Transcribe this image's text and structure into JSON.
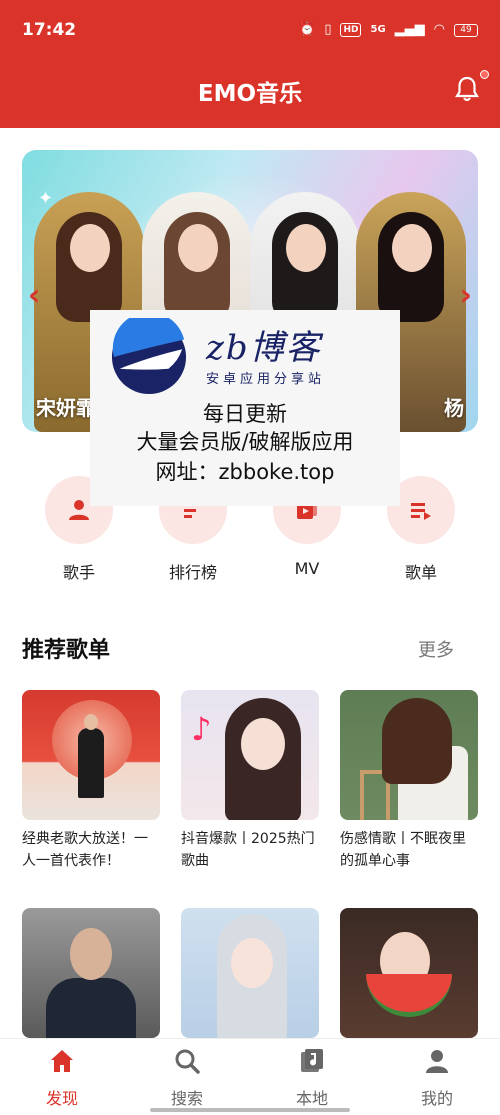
{
  "status_bar": {
    "time": "17:42",
    "hd": "HD",
    "network": "5G",
    "battery": "49"
  },
  "header": {
    "title": "EMO音乐",
    "icon": "bell-icon",
    "accent_color": "#d9332a"
  },
  "banner": {
    "caption_left": "宋妍霏",
    "caption_right": "杨"
  },
  "watermark": {
    "brand": "zb博客",
    "sub": "安卓应用分享站",
    "line1": "每日更新",
    "line2": "大量会员版/破解版应用",
    "line3": "网址：zbboke.top"
  },
  "categories": [
    {
      "label": "歌手",
      "icon": "singer-icon"
    },
    {
      "label": "排行榜",
      "icon": "ranking-icon"
    },
    {
      "label": "MV",
      "icon": "mv-icon"
    },
    {
      "label": "歌单",
      "icon": "playlist-icon"
    }
  ],
  "recommended": {
    "title": "推荐歌单",
    "more": "更多",
    "playlists": [
      {
        "title": "经典老歌大放送！一人一首代表作！"
      },
      {
        "title": "抖音爆款丨2025热门歌曲"
      },
      {
        "title": "伤感情歌丨不眠夜里的孤单心事"
      },
      {
        "title": ""
      },
      {
        "title": ""
      },
      {
        "title": ""
      }
    ]
  },
  "bottom_nav": [
    {
      "label": "发现",
      "icon": "home-icon",
      "active": true
    },
    {
      "label": "搜索",
      "icon": "search-icon",
      "active": false
    },
    {
      "label": "本地",
      "icon": "music-file-icon",
      "active": false
    },
    {
      "label": "我的",
      "icon": "user-icon",
      "active": false
    }
  ]
}
